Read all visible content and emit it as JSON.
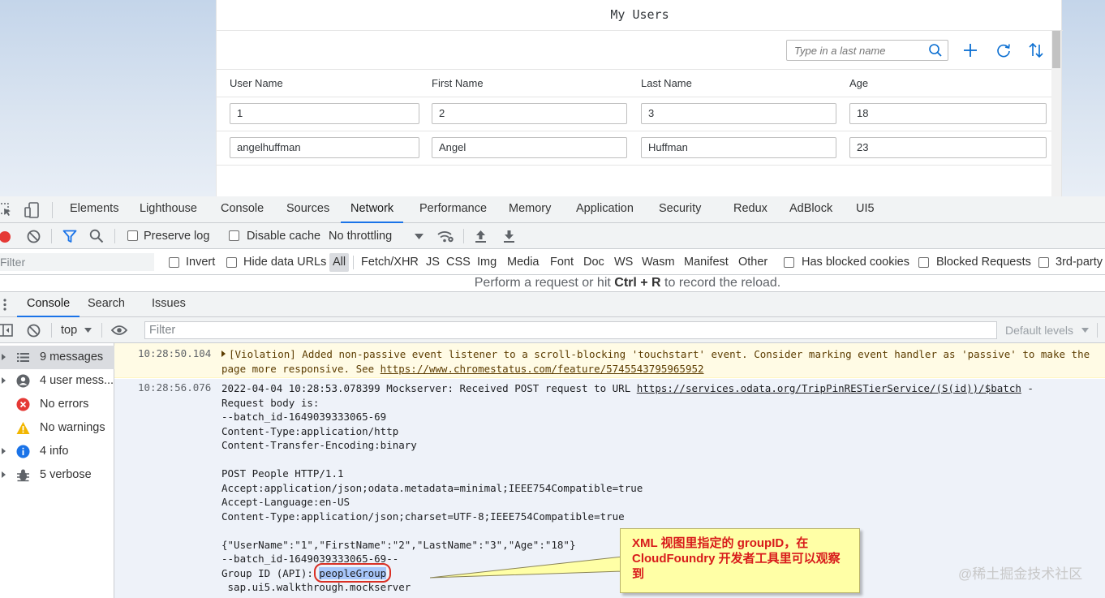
{
  "app": {
    "title": "My Users",
    "search_placeholder": "Type in a last name",
    "columns": [
      "User Name",
      "First Name",
      "Last Name",
      "Age"
    ],
    "rows": [
      [
        "1",
        "2",
        "3",
        "18"
      ],
      [
        "angelhuffman",
        "Angel",
        "Huffman",
        "23"
      ]
    ]
  },
  "devtools": {
    "tabs": [
      "Elements",
      "Lighthouse",
      "Console",
      "Sources",
      "Network",
      "Performance",
      "Memory",
      "Application",
      "Security",
      "Redux",
      "AdBlock",
      "UI5"
    ],
    "network_toolbar": {
      "preserve_log": "Preserve log",
      "disable_cache": "Disable cache",
      "throttling": "No throttling"
    },
    "filter_bar": {
      "placeholder": "Filter",
      "invert": "Invert",
      "hide_data_urls": "Hide data URLs",
      "types": [
        "All",
        "Fetch/XHR",
        "JS",
        "CSS",
        "Img",
        "Media",
        "Font",
        "Doc",
        "WS",
        "Wasm",
        "Manifest",
        "Other"
      ],
      "has_blocked_cookies": "Has blocked cookies",
      "blocked_requests": "Blocked Requests",
      "third_party": "3rd-party"
    },
    "empty_hint": {
      "prefix": "Perform a request or hit ",
      "shortcut": "Ctrl + R",
      "suffix": " to record the reload."
    },
    "drawer_tabs": [
      "Console",
      "Search",
      "Issues"
    ],
    "console_toolbar": {
      "context": "top",
      "filter_placeholder": "Filter",
      "levels": "Default levels"
    },
    "sidebar": [
      {
        "label": "9 messages",
        "icon": "list-icon"
      },
      {
        "label": "4 user mess...",
        "icon": "user-icon"
      },
      {
        "label": "No errors",
        "icon": "error-icon"
      },
      {
        "label": "No warnings",
        "icon": "warning-icon"
      },
      {
        "label": "4 info",
        "icon": "info-icon"
      },
      {
        "label": "5 verbose",
        "icon": "bug-icon"
      }
    ],
    "messages": {
      "warning": {
        "time": "10:28:50.104",
        "text": "[Violation] Added non-passive event listener to a scroll-blocking 'touchstart' event. Consider marking event handler as 'passive' to make the page more responsive. See ",
        "link": "https://www.chromestatus.com/feature/5745543795965952"
      },
      "info": {
        "time": "10:28:56.076",
        "line1_prefix": "2022-04-04 10:28:53.078399 Mockserver: Received POST request to URL ",
        "line1_link": "https://services.odata.org/TripPinRESTierService/(S(id))/$batch",
        "line1_suffix": " -",
        "body": "Request body is:\n--batch_id-1649039333065-69\nContent-Type:application/http\nContent-Transfer-Encoding:binary\n\nPOST People HTTP/1.1\nAccept:application/json;odata.metadata=minimal;IEEE754Compatible=true\nAccept-Language:en-US\nContent-Type:application/json;charset=UTF-8;IEEE754Compatible=true\n\n{\"UserName\":\"1\",\"FirstName\":\"2\",\"LastName\":\"3\",\"Age\":\"18\"}\n--batch_id-1649039333065-69--",
        "group_prefix": "Group ID (API): ",
        "group_value": "peopleGroup",
        "last_line": " sap.ui5.walkthrough.mockserver"
      }
    }
  },
  "callout": {
    "text": "XML 视图里指定的 groupID，在 CloudFoundry 开发者工具里可以观察到"
  },
  "watermark": "@稀土掘金技术社区",
  "colors": {
    "accent": "#1a73e8",
    "record_red": "#e53935",
    "callout_bg": "#ffffa6",
    "callout_text": "#d81b1b"
  }
}
